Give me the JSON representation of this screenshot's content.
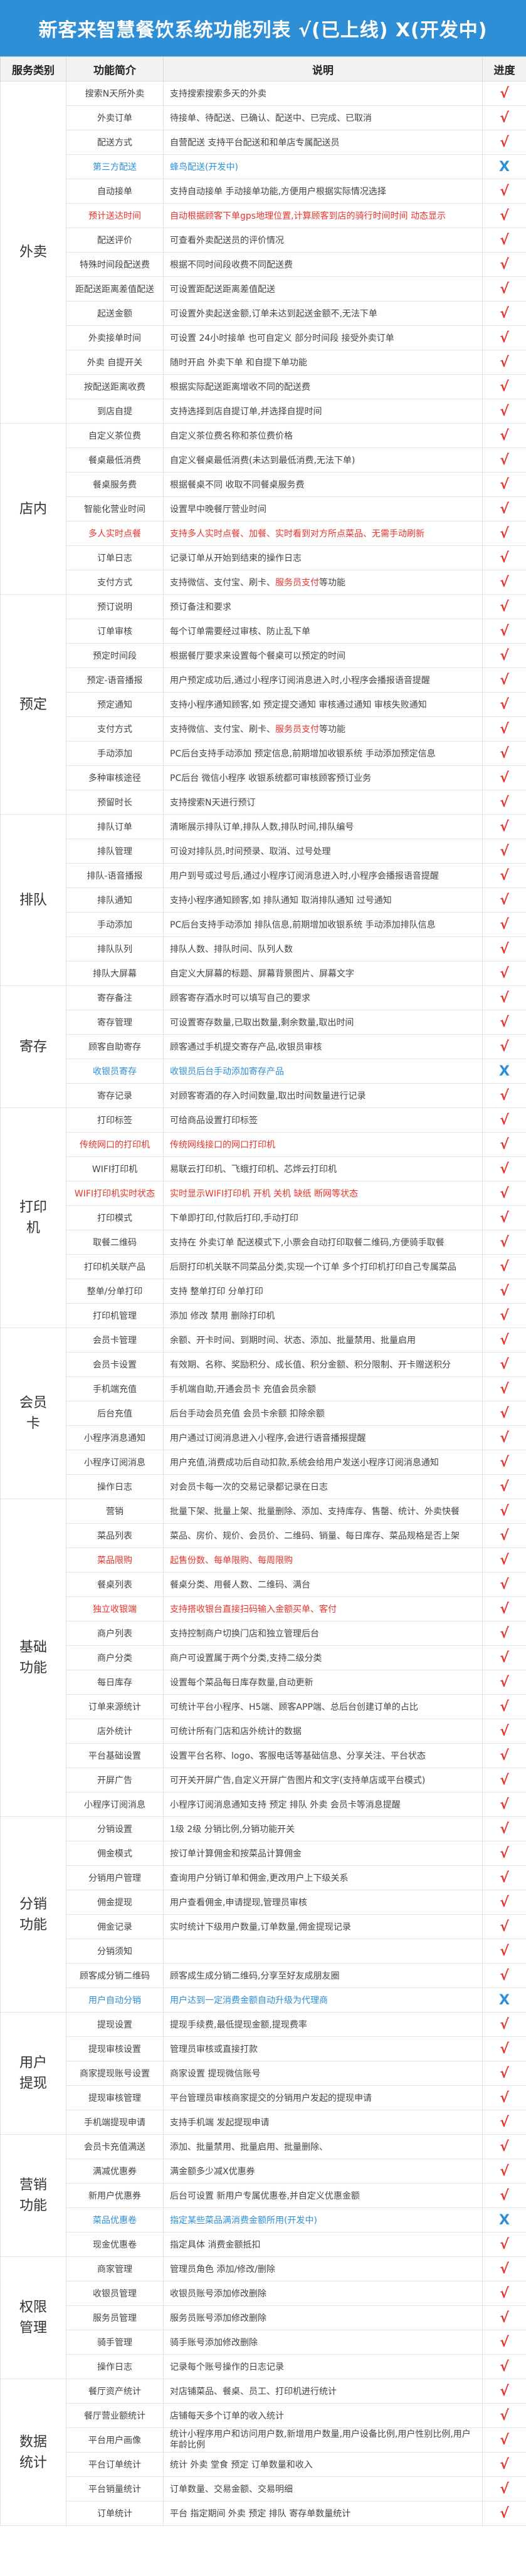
{
  "title": "新客来智慧餐饮系统功能列表 √(已上线) X(开发中)",
  "headers": [
    "服务类别",
    "功能简介",
    "说明",
    "进度"
  ],
  "colors": {
    "header_bg": "#2f8fd6",
    "red_text": "#e8332d",
    "blue_text": "#2f8fd6",
    "done_mark": "#e8332d",
    "dev_mark": "#2f8fd6"
  },
  "status_symbols": {
    "done": "√",
    "dev": "X"
  },
  "categories": [
    {
      "name": "外卖",
      "rows": [
        {
          "f": "搜索N天所外卖",
          "d": "支持搜索搜索多天的外卖",
          "s": "done"
        },
        {
          "f": "外卖订单",
          "d": "待接单、待配送、已确认、配送中、已完成、已取消",
          "s": "done"
        },
        {
          "f": "配送方式",
          "d": "自营配送 支持平台配送和和单店专属配送员",
          "s": "done"
        },
        {
          "f": "第三方配送",
          "d": "蜂鸟配送(开发中)",
          "s": "dev",
          "c": "blue"
        },
        {
          "f": "自动接单",
          "d": "支持自动接单 手动接单功能,方便用户根据实际情况选择",
          "s": "done"
        },
        {
          "f": "预计送达时间",
          "d": "自动根据顾客下单gps地理位置,计算顾客到店的骑行时间时间 动态显示",
          "s": "done",
          "c": "red"
        },
        {
          "f": "配送评价",
          "d": "可查看外卖配送员的评价情况",
          "s": "done"
        },
        {
          "f": "特殊时间段配送费",
          "d": "根据不同时间段收费不同配送费",
          "s": "done"
        },
        {
          "f": "距配送距离差值配送",
          "d": "可设置距配送距离差值配送",
          "s": "done"
        },
        {
          "f": "起送金额",
          "d": "可设置外卖起送金额,订单未达到起送金额不,无法下单",
          "s": "done"
        },
        {
          "f": "外卖接单时间",
          "d": "可设置 24小时接单 也可自定义 部分时间段 接受外卖订单",
          "s": "done"
        },
        {
          "f": "外卖 自提开关",
          "d": "随时开启 外卖下单 和自提下单功能",
          "s": "done"
        },
        {
          "f": "按配送距离收费",
          "d": "根据实际配送距离增收不同的配送费",
          "s": "done"
        },
        {
          "f": "到店自提",
          "d": "支持选择到店自提订单,并选择自提时间",
          "s": "done"
        }
      ]
    },
    {
      "name": "店内",
      "rows": [
        {
          "f": "自定义茶位费",
          "d": "自定义茶位费名称和茶位费价格",
          "s": "done"
        },
        {
          "f": "餐桌最低消费",
          "d": "自定义餐桌最低消费(未达到最低消费,无法下单)",
          "s": "done"
        },
        {
          "f": "餐桌服务费",
          "d": "根据餐桌不同 收取不同餐桌服务费",
          "s": "done"
        },
        {
          "f": "智能化营业时间",
          "d": "设置早中晚餐厅营业时间",
          "s": "done"
        },
        {
          "f": "多人实时点餐",
          "d": "支持多人实时点餐、加餐、实时看到对方所点菜品、无需手动刷新",
          "s": "done",
          "c": "red"
        },
        {
          "f": "订单日志",
          "d": "记录订单从开始到结束的操作日志",
          "s": "done"
        },
        {
          "f": "支付方式",
          "d": "支持微信、支付宝、刷卡、服务员支付等功能",
          "s": "done",
          "hl": "服务员支付"
        }
      ]
    },
    {
      "name": "预定",
      "rows": [
        {
          "f": "预订说明",
          "d": "预订备注和要求",
          "s": "done"
        },
        {
          "f": "订单审核",
          "d": "每个订单需要经过审核、防止乱下单",
          "s": "done"
        },
        {
          "f": "预定时间段",
          "d": "根据餐厅要求来设置每个餐桌可以预定的时间",
          "s": "done"
        },
        {
          "f": "预定-语音播报",
          "d": "用户预定成功后,通过小程序订阅消息进入时,小程序会播报语音提醒",
          "s": "done"
        },
        {
          "f": "预定通知",
          "d": "支持小程序通知顾客,如 预定提交通知 审核通过通知 审核失败通知",
          "s": "done"
        },
        {
          "f": "支付方式",
          "d": "支持微信、支付宝、刷卡、服务员支付等功能",
          "s": "done",
          "hl": "服务员支付"
        },
        {
          "f": "手动添加",
          "d": "PC后台支持手动添加 预定信息,前期增加收银系统 手动添加预定信息",
          "s": "done"
        },
        {
          "f": "多种审核途径",
          "d": "PC后台 微信小程序 收银系统都可审核顾客预订业务",
          "s": "done"
        },
        {
          "f": "预留时长",
          "d": "支持搜索N天进行预订",
          "s": "done"
        }
      ]
    },
    {
      "name": "排队",
      "rows": [
        {
          "f": "排队订单",
          "d": "清晰展示排队订单,排队人数,排队时间,排队编号",
          "s": "done"
        },
        {
          "f": "排队管理",
          "d": "可设对排队员,时间预录、取消、过号处理",
          "s": "done"
        },
        {
          "f": "排队-语音播报",
          "d": "用户到号或过号后,通过小程序订阅消息进入时,小程序会播报语音提醒",
          "s": "done"
        },
        {
          "f": "排队通知",
          "d": "支持小程序通知顾客,如 排队通知 取消排队通知 过号通知",
          "s": "done"
        },
        {
          "f": "手动添加",
          "d": "PC后台支持手动添加 排队信息,前期增加收银系统 手动添加排队信息",
          "s": "done"
        },
        {
          "f": "排队队列",
          "d": "排队人数、排队时间、队列人数",
          "s": "done"
        },
        {
          "f": "排队大屏幕",
          "d": "自定义大屏幕的标题、屏幕背景图片、屏幕文字",
          "s": "done"
        }
      ]
    },
    {
      "name": "寄存",
      "rows": [
        {
          "f": "寄存备注",
          "d": "顾客寄存酒水时可以填写自己的要求",
          "s": "done"
        },
        {
          "f": "寄存管理",
          "d": "可设置寄存数量,已取出数量,剩余数量,取出时间",
          "s": "done"
        },
        {
          "f": "顾客自助寄存",
          "d": "顾客通过手机提交寄存产品,收银员审核",
          "s": "done"
        },
        {
          "f": "收银员寄存",
          "d": "收银员后台手动添加寄存产品",
          "s": "dev",
          "c": "blue"
        },
        {
          "f": "寄存记录",
          "d": "对顾客寄酒的存入时间数量,取出时间数量进行记录",
          "s": "done"
        }
      ]
    },
    {
      "name": "打印机",
      "rows": [
        {
          "f": "打印标签",
          "d": "可给商品设置打印标签",
          "s": "done"
        },
        {
          "f": "传统网口的打印机",
          "d": "传统网线接口的网口打印机",
          "s": "done",
          "c": "red"
        },
        {
          "f": "WIFI打印机",
          "d": "易联云打印机、飞蛾打印机、芯烨云打印机",
          "s": "done"
        },
        {
          "f": "WIFI打印机实时状态",
          "d": "实时显示WIFI打印机 开机 关机 缺纸 断网等状态",
          "s": "done",
          "c": "red"
        },
        {
          "f": "打印模式",
          "d": "下单即打印,付款后打印,手动打印",
          "s": "done"
        },
        {
          "f": "取餐二维码",
          "d": "支持在 外卖订单 配送模式下,小票会自动打印取餐二维码,方便骑手取餐",
          "s": "done"
        },
        {
          "f": "打印机关联产品",
          "d": "后厨打印机关联不同菜品分类,实现一个订单 多个打印机打印自己专属菜品",
          "s": "done"
        },
        {
          "f": "整单/分单打印",
          "d": "支持 整单打印 分单打印",
          "s": "done"
        },
        {
          "f": "打印机管理",
          "d": "添加 修改 禁用 删除打印机",
          "s": "done"
        }
      ]
    },
    {
      "name": "会员卡",
      "rows": [
        {
          "f": "会员卡管理",
          "d": "余额、开卡时间、到期时间、状态、添加、批量禁用、批量启用",
          "s": "done"
        },
        {
          "f": "会员卡设置",
          "d": "有效期、名称、奖励积分、成长值、积分金额、积分限制、开卡赠送积分",
          "s": "done"
        },
        {
          "f": "手机端充值",
          "d": "手机端自助,开通会员卡 充值会员余额",
          "s": "done"
        },
        {
          "f": "后台充值",
          "d": "后台手动会员充值 会员卡余额 扣除余额",
          "s": "done"
        },
        {
          "f": "小程序消息通知",
          "d": "用户通过订阅消息进入小程序,会进行语音播报提醒",
          "s": "done"
        },
        {
          "f": "小程序订阅消息",
          "d": "用户充值,消费成功后自动扣款,系统会给用户发送小程序订阅消息通知",
          "s": "done"
        },
        {
          "f": "操作日志",
          "d": "对会员卡每一次的交易记录都记录在日志",
          "s": "done"
        }
      ]
    },
    {
      "name": "基础功能",
      "rows": [
        {
          "f": "营销",
          "d": "批量下架、批量上架、批量删除、添加、支持库存、售罄、统计、外卖快餐",
          "s": "done"
        },
        {
          "f": "菜品列表",
          "d": "菜品、房价、规价、会员价、二维码、销量、每日库存、菜品规格是否上架",
          "s": "done"
        },
        {
          "f": "菜品限购",
          "d": "起售份数、每单限购、每周限购",
          "s": "done",
          "c": "red"
        },
        {
          "f": "餐桌列表",
          "d": "餐桌分类、用餐人数、二维码、满台",
          "s": "done"
        },
        {
          "f": "独立收银端",
          "d": "支持搭收银台直接扫码输入金额买单、客付",
          "s": "done",
          "c": "red"
        },
        {
          "f": "商户列表",
          "d": "支持控制商户切换门店和独立管理后台",
          "s": "done"
        },
        {
          "f": "商户分类",
          "d": "商户可设置属于两个分类,支持二级分类",
          "s": "done"
        },
        {
          "f": "每日库存",
          "d": "设置每个菜品每日库存数量,自动更新",
          "s": "done"
        },
        {
          "f": "订单来源统计",
          "d": "可统计平台小程序、H5端、顾客APP端、总后台创建订单的占比",
          "s": "done"
        },
        {
          "f": "店外统计",
          "d": "可统计所有门店和店外统计的数据",
          "s": "done"
        },
        {
          "f": "平台基础设置",
          "d": "设置平台名称、logo、客服电话等基础信息、分享关注、平台状态",
          "s": "done"
        },
        {
          "f": "开屏广告",
          "d": "可开关开屏广告,自定义开屏广告图片和文字(支持单店或平台模式)",
          "s": "done"
        },
        {
          "f": "小程序订阅消息",
          "d": "小程序订阅消息通知支持 预定 排队 外卖 会员卡等消息提醒",
          "s": "done"
        }
      ]
    },
    {
      "name": "分销功能",
      "rows": [
        {
          "f": "分销设置",
          "d": "1级 2级 分销比例,分销功能开关",
          "s": "done"
        },
        {
          "f": "佣金模式",
          "d": "按订单计算佣金和按菜品计算佣金",
          "s": "done"
        },
        {
          "f": "分销用户管理",
          "d": "查询用户分销订单和佣金,更改用户上下级关系",
          "s": "done"
        },
        {
          "f": "佣金提现",
          "d": "用户查看佣金,申请提现,管理员审核",
          "s": "done"
        },
        {
          "f": "佣金记录",
          "d": "实时统计下级用户数量,订单数量,佣金提现记录",
          "s": "done"
        },
        {
          "f": "分销须知",
          "d": "",
          "s": "done"
        },
        {
          "f": "顾客成分销二维码",
          "d": "顾客成生成分销二维码,分享至好友成朋友圈",
          "s": "done"
        },
        {
          "f": "用户自动分销",
          "d": "用户达到一定消费金额自动升级为代理商",
          "s": "dev",
          "c": "blue"
        }
      ]
    },
    {
      "name": "用户提现",
      "rows": [
        {
          "f": "提现设置",
          "d": "提现手续费,最低提现金额,提现费率",
          "s": "done"
        },
        {
          "f": "提现审核设置",
          "d": "管理员审核或直接打款",
          "s": "done"
        },
        {
          "f": "商家提现账号设置",
          "d": "商家设置 提现微信账号",
          "s": "done"
        },
        {
          "f": "提现审核管理",
          "d": "平台管理员审核商家提交的分销用户发起的提现申请",
          "s": "done"
        },
        {
          "f": "手机端提现申请",
          "d": "支持手机端 发起提现申请",
          "s": "done"
        }
      ]
    },
    {
      "name": "营销功能",
      "rows": [
        {
          "f": "会员卡充值满送",
          "d": "添加、批量禁用、批量启用、批量删除、",
          "s": "done"
        },
        {
          "f": "满减优惠券",
          "d": "满金额多少减X优惠券",
          "s": "done"
        },
        {
          "f": "新用户优惠券",
          "d": "后台可设置 新用户专属优惠卷,并自定义优惠金额",
          "s": "done"
        },
        {
          "f": "菜品优惠卷",
          "d": "指定某些菜品满消费金额所用(开发中)",
          "s": "dev",
          "c": "blue"
        },
        {
          "f": "现金优惠卷",
          "d": "指定具体 消费金额抵扣",
          "s": "done"
        }
      ]
    },
    {
      "name": "权限管理",
      "rows": [
        {
          "f": "商家管理",
          "d": "管理员角色 添加/修改/删除",
          "s": "done"
        },
        {
          "f": "收银员管理",
          "d": "收银员账号添加修改删除",
          "s": "done"
        },
        {
          "f": "服务员管理",
          "d": "服务员账号添加修改删除",
          "s": "done"
        },
        {
          "f": "骑手管理",
          "d": "骑手账号添加修改删除",
          "s": "done"
        },
        {
          "f": "操作日志",
          "d": "记录每个账号操作的日志记录",
          "s": "done"
        }
      ]
    },
    {
      "name": "数据统计",
      "rows": [
        {
          "f": "餐厅资产统计",
          "d": "对店铺菜品、餐桌、员工、打印机进行统计",
          "s": "done"
        },
        {
          "f": "餐厅营业额统计",
          "d": "店铺每天多个订单的收入统计",
          "s": "done"
        },
        {
          "f": "平台用户画像",
          "d": "统计小程序用户和访问用户数,新增用户数量,用户设备比例,用户性别比例,用户年龄比例",
          "s": "done",
          "wrap": true
        },
        {
          "f": "平台订单统计",
          "d": "统计 外卖 堂食 预定 订单数量和收入",
          "s": "done"
        },
        {
          "f": "平台销量统计",
          "d": "订单数量、交易金额、交易明细",
          "s": "done"
        },
        {
          "f": "订单统计",
          "d": "平台 指定期间 外卖 预定 排队 寄存单数量统计",
          "s": "done"
        }
      ]
    }
  ]
}
